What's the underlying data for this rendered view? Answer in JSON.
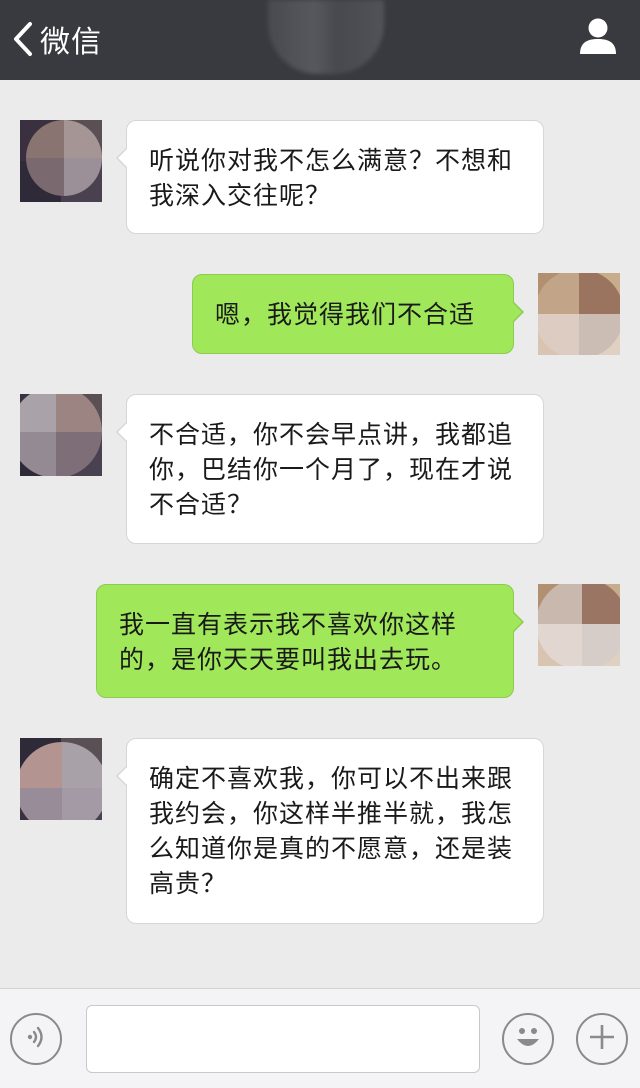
{
  "header": {
    "back_label": "微信",
    "back_icon": "chevron-left-icon",
    "profile_icon": "person-icon",
    "background": "#393a3f"
  },
  "messages": [
    {
      "side": "left",
      "text": "听说你对我不怎么满意？不想和我深入交往呢？"
    },
    {
      "side": "right",
      "text": "嗯，我觉得我们不合适"
    },
    {
      "side": "left",
      "text": "不合适，你不会早点讲，我都追你，巴结你一个月了，现在才说不合适？"
    },
    {
      "side": "right",
      "text": "我一直有表示我不喜欢你这样的，是你天天要叫我出去玩。"
    },
    {
      "side": "left",
      "text": "确定不喜欢我，你可以不出来跟我约会，你这样半推半就，我怎么知道你是真的不愿意，还是装高贵？"
    }
  ],
  "input_bar": {
    "voice_icon": "voice-icon",
    "emoji_icon": "smiley-icon",
    "plus_icon": "plus-icon",
    "input_value": ""
  },
  "colors": {
    "background": "#ebebeb",
    "bubble_sent": "#a0e75a",
    "bubble_received": "#ffffff"
  }
}
